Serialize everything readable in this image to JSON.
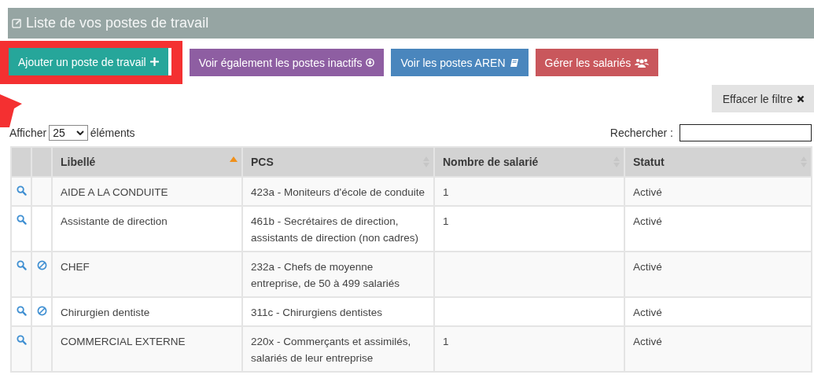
{
  "panel": {
    "title": "Liste de vos postes de travail"
  },
  "buttons": [
    {
      "label": "Ajouter un poste de travail",
      "kind": "add",
      "highlighted": true
    },
    {
      "label": "Voir également les postes inactifs",
      "kind": "inactive",
      "highlighted": false
    },
    {
      "label": "Voir les postes AREN",
      "kind": "aren",
      "highlighted": false
    },
    {
      "label": "Gérer les salariés",
      "kind": "staff",
      "highlighted": false
    }
  ],
  "clear_filter": {
    "label": "Effacer le filtre"
  },
  "length": {
    "prefix": "Afficher",
    "value": "25",
    "suffix": "éléments"
  },
  "search": {
    "label": "Rechercher :"
  },
  "table": {
    "columns": [
      {
        "label": "Libellé",
        "sorted": true
      },
      {
        "label": "PCS",
        "sorted": false
      },
      {
        "label": "Nombre de salarié",
        "sorted": false
      },
      {
        "label": "Statut",
        "sorted": false
      }
    ],
    "rows": [
      {
        "ban_icon": false,
        "cells": [
          "AIDE A LA CONDUITE",
          "423a - Moniteurs d'école de conduite",
          "1",
          "Activé"
        ]
      },
      {
        "ban_icon": false,
        "cells": [
          "Assistante de direction",
          "461b - Secrétaires de direction, assistants de direction (non cadres)",
          "1",
          "Activé"
        ]
      },
      {
        "ban_icon": true,
        "cells": [
          "CHEF",
          "232a - Chefs de moyenne entreprise, de 50 à 499 salariés",
          "",
          "Activé"
        ]
      },
      {
        "ban_icon": true,
        "cells": [
          "Chirurgien dentiste",
          "311c - Chirurgiens dentistes",
          "",
          "Activé"
        ]
      },
      {
        "ban_icon": false,
        "cells": [
          "COMMERCIAL EXTERNE",
          "220x - Commerçants et assimilés, salariés de leur entreprise",
          "1",
          "Activé"
        ]
      }
    ]
  }
}
